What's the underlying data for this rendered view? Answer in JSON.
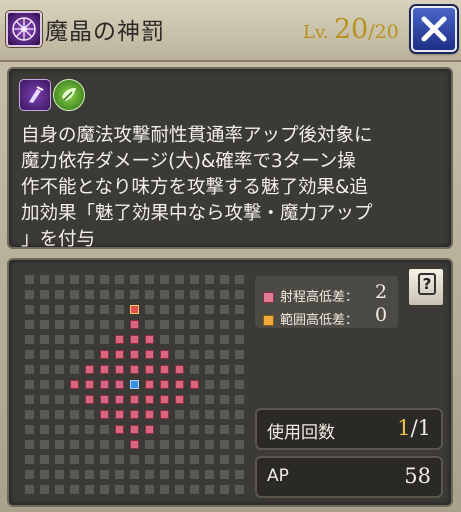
{
  "header": {
    "title": "魔晶の神罰",
    "level_prefix": "Lv.",
    "level_current": "20",
    "level_max": "/20",
    "close_icon": "x-icon"
  },
  "description": {
    "icons": [
      "magic-piercing-icon",
      "charm-status-icon"
    ],
    "text": "自身の魔法攻撃耐性貫通率アップ後対象に\n魔力依存ダメージ(大)&確率で3ターン操\n作不能となり味方を攻撃する魅了効果&追\n加効果「魅了効果中なら攻撃・魔力アップ\n」を付与"
  },
  "range": {
    "legend": [
      {
        "label": "射程高低差：",
        "value": "2",
        "color": "#e07a95"
      },
      {
        "label": "範囲高低差：",
        "value": "0",
        "color": "#f0a93b"
      }
    ],
    "help_label": "?"
  },
  "stats": {
    "uses_label": "使用回数",
    "uses_current": "1",
    "uses_max": "/1",
    "ap_label": "AP",
    "ap_value": "58"
  },
  "colors": {
    "range_cell": "#d9667e",
    "target_cell": "#e4504d",
    "center_cell": "#3b8fe0",
    "level": "#b8921f",
    "close_button": "#2a41a8"
  }
}
